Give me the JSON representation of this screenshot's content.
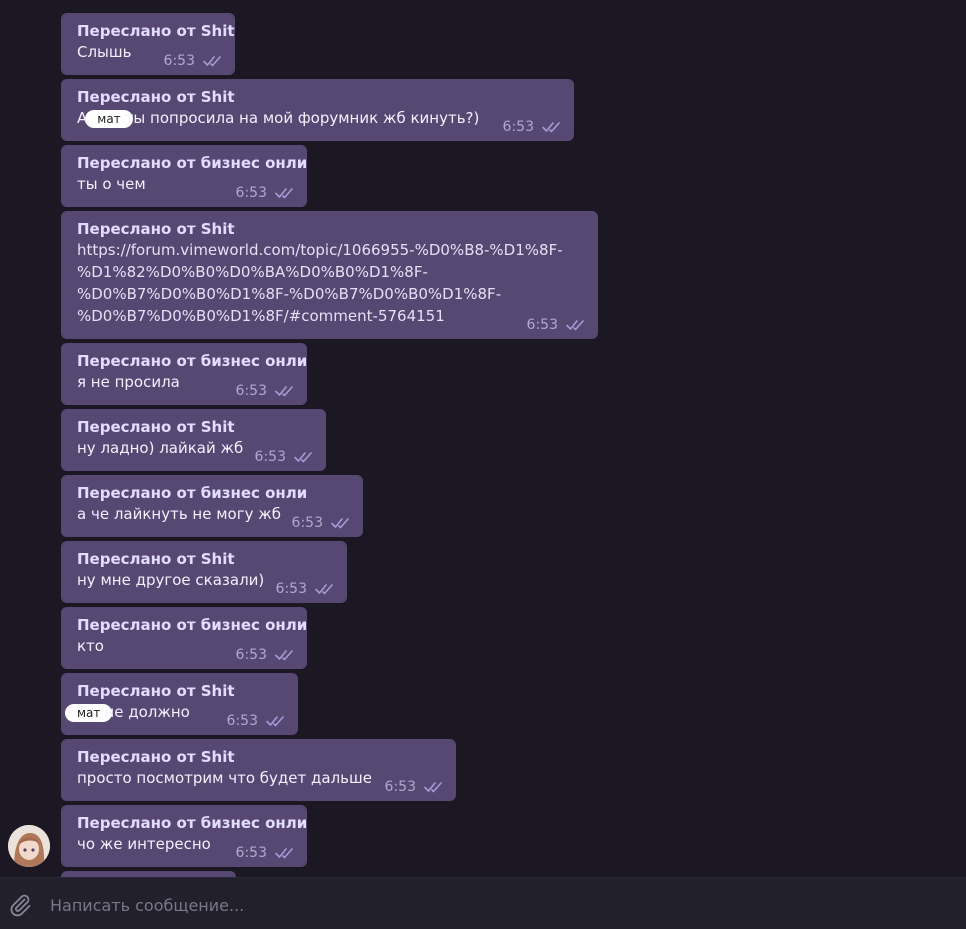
{
  "messages": [
    {
      "forwarded_from": "Переслано от Shit",
      "text": "Слышь",
      "time": "6:53"
    },
    {
      "forwarded_from": "Переслано от Shit",
      "text_before": "А",
      "censor_label": "мат",
      "text_after": "ты попросила на мой форумник жб кинуть?)",
      "time": "6:53"
    },
    {
      "forwarded_from": "Переслано от бизнес онли",
      "text": "ты о чем",
      "time": "6:53"
    },
    {
      "forwarded_from": "Переслано от Shit",
      "link_lines": [
        "https://forum.vimeworld.com/topic/1066955-%D0%B8-%D1%8F-",
        "%D1%82%D0%B0%D0%BA%D0%B0%D1%8F-",
        "%D0%B7%D0%B0%D1%8F-%D0%B7%D0%B0%D1%8F-",
        "%D0%B7%D0%B0%D1%8F/#comment-5764151"
      ],
      "time": "6:53"
    },
    {
      "forwarded_from": "Переслано от бизнес онли",
      "text": "я не просила",
      "time": "6:53"
    },
    {
      "forwarded_from": "Переслано от Shit",
      "text": "ну ладно) лайкай жб",
      "time": "6:53"
    },
    {
      "forwarded_from": "Переслано от бизнес онли",
      "text": "а че лайкнуть не могу жб",
      "time": "6:53"
    },
    {
      "forwarded_from": "Переслано от Shit",
      "text": "ну мне другое сказали)",
      "time": "6:53"
    },
    {
      "forwarded_from": "Переслано от бизнес онли",
      "text": "кто",
      "time": "6:53"
    },
    {
      "forwarded_from": "Переслано от Shit",
      "censor_label": "мат",
      "text_after": "не должно",
      "time": "6:53"
    },
    {
      "forwarded_from": "Переслано от Shit",
      "text": "просто посмотрим что будет дальше",
      "time": "6:53"
    },
    {
      "forwarded_from": "Переслано от бизнес онли",
      "text": "чо же интересно",
      "time": "6:53"
    }
  ],
  "composer": {
    "placeholder": "Написать сообщение..."
  },
  "colors": {
    "background": "#1b1823",
    "bubble": "#564872",
    "check": "#a99ad6"
  },
  "icons": {
    "attach": "paperclip-icon",
    "read_status": "double-check-icon"
  }
}
